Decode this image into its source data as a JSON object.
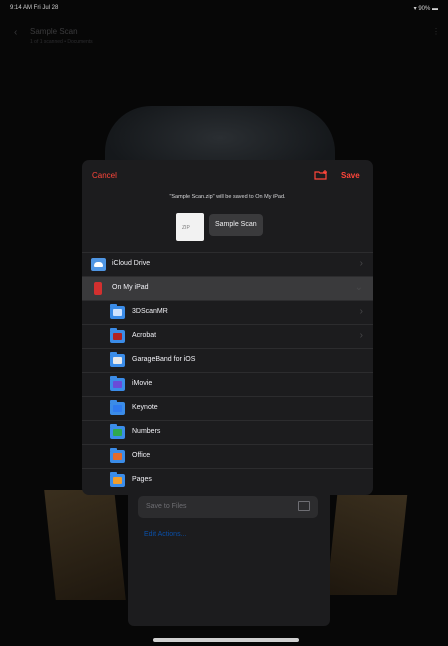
{
  "status_bar": {
    "time": "9:14 AM  Fri Jul 28",
    "battery": "▾ 90% ▬"
  },
  "background": {
    "title": "Sample Scan",
    "subtitle": "1 of 1 scanned • Documents",
    "save_field_placeholder": "Save to Files",
    "edit_actions_label": "Edit Actions..."
  },
  "sheet": {
    "cancel_label": "Cancel",
    "save_label": "Save",
    "message": "\"Sample Scan.zip\" will be saved to On My iPad.",
    "file_icon_text": "ZIP",
    "file_name": "Sample Scan",
    "locations": [
      {
        "label": "iCloud Drive",
        "icon": "icloud-icon",
        "selected": false,
        "chevron": "›"
      },
      {
        "label": "On My iPad",
        "icon": "ipad-icon",
        "selected": true,
        "chevron": "⌄"
      }
    ],
    "folders": [
      {
        "label": "3DScanMR",
        "icon": "folder-icon",
        "chevron": "›"
      },
      {
        "label": "Acrobat",
        "icon": "folder-icon",
        "chevron": "›"
      },
      {
        "label": "GarageBand for iOS",
        "icon": "folder-icon",
        "chevron": ""
      },
      {
        "label": "iMovie",
        "icon": "folder-icon",
        "chevron": ""
      },
      {
        "label": "Keynote",
        "icon": "folder-icon",
        "chevron": ""
      },
      {
        "label": "Numbers",
        "icon": "folder-icon",
        "chevron": ""
      },
      {
        "label": "Office",
        "icon": "folder-icon",
        "chevron": ""
      },
      {
        "label": "Pages",
        "icon": "folder-icon",
        "chevron": ""
      }
    ]
  },
  "colors": {
    "accent": "#ff453a",
    "folder": "#3b8ce8",
    "sheet_bg": "#1c1c1e"
  }
}
